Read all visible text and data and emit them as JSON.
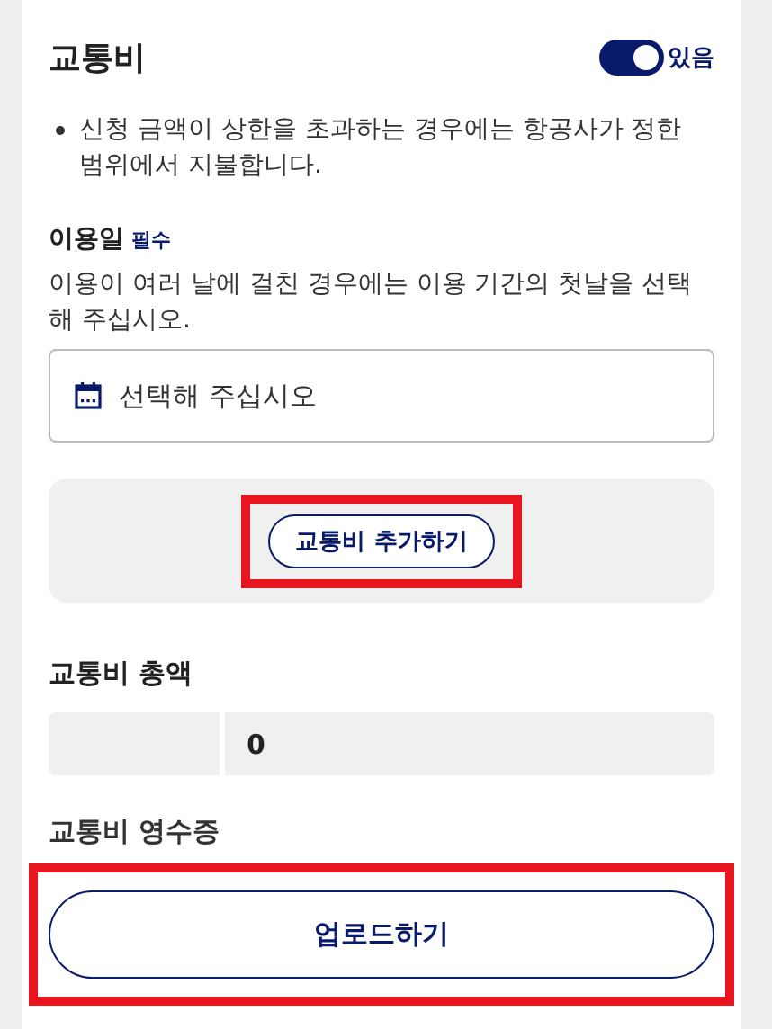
{
  "section": {
    "title": "교통비",
    "toggle": {
      "on": true,
      "label": "있음"
    },
    "notes": [
      "신청 금액이 상한을 초과하는 경우에는 항공사가 정한 범위에서 지불합니다."
    ],
    "date_field": {
      "label": "이용일",
      "required_tag": "필수",
      "help": "이용이 여러 날에 걸친 경우에는 이용 기간의 첫날을 선택해 주십시오.",
      "placeholder": "선택해 주십시오"
    },
    "add_button": {
      "label": "교통비 추가하기",
      "highlighted": true
    },
    "total": {
      "label": "교통비 총액",
      "value": "0"
    },
    "receipt": {
      "label": "교통비 영수증",
      "button": {
        "label": "업로드하기",
        "highlighted": true
      }
    }
  }
}
